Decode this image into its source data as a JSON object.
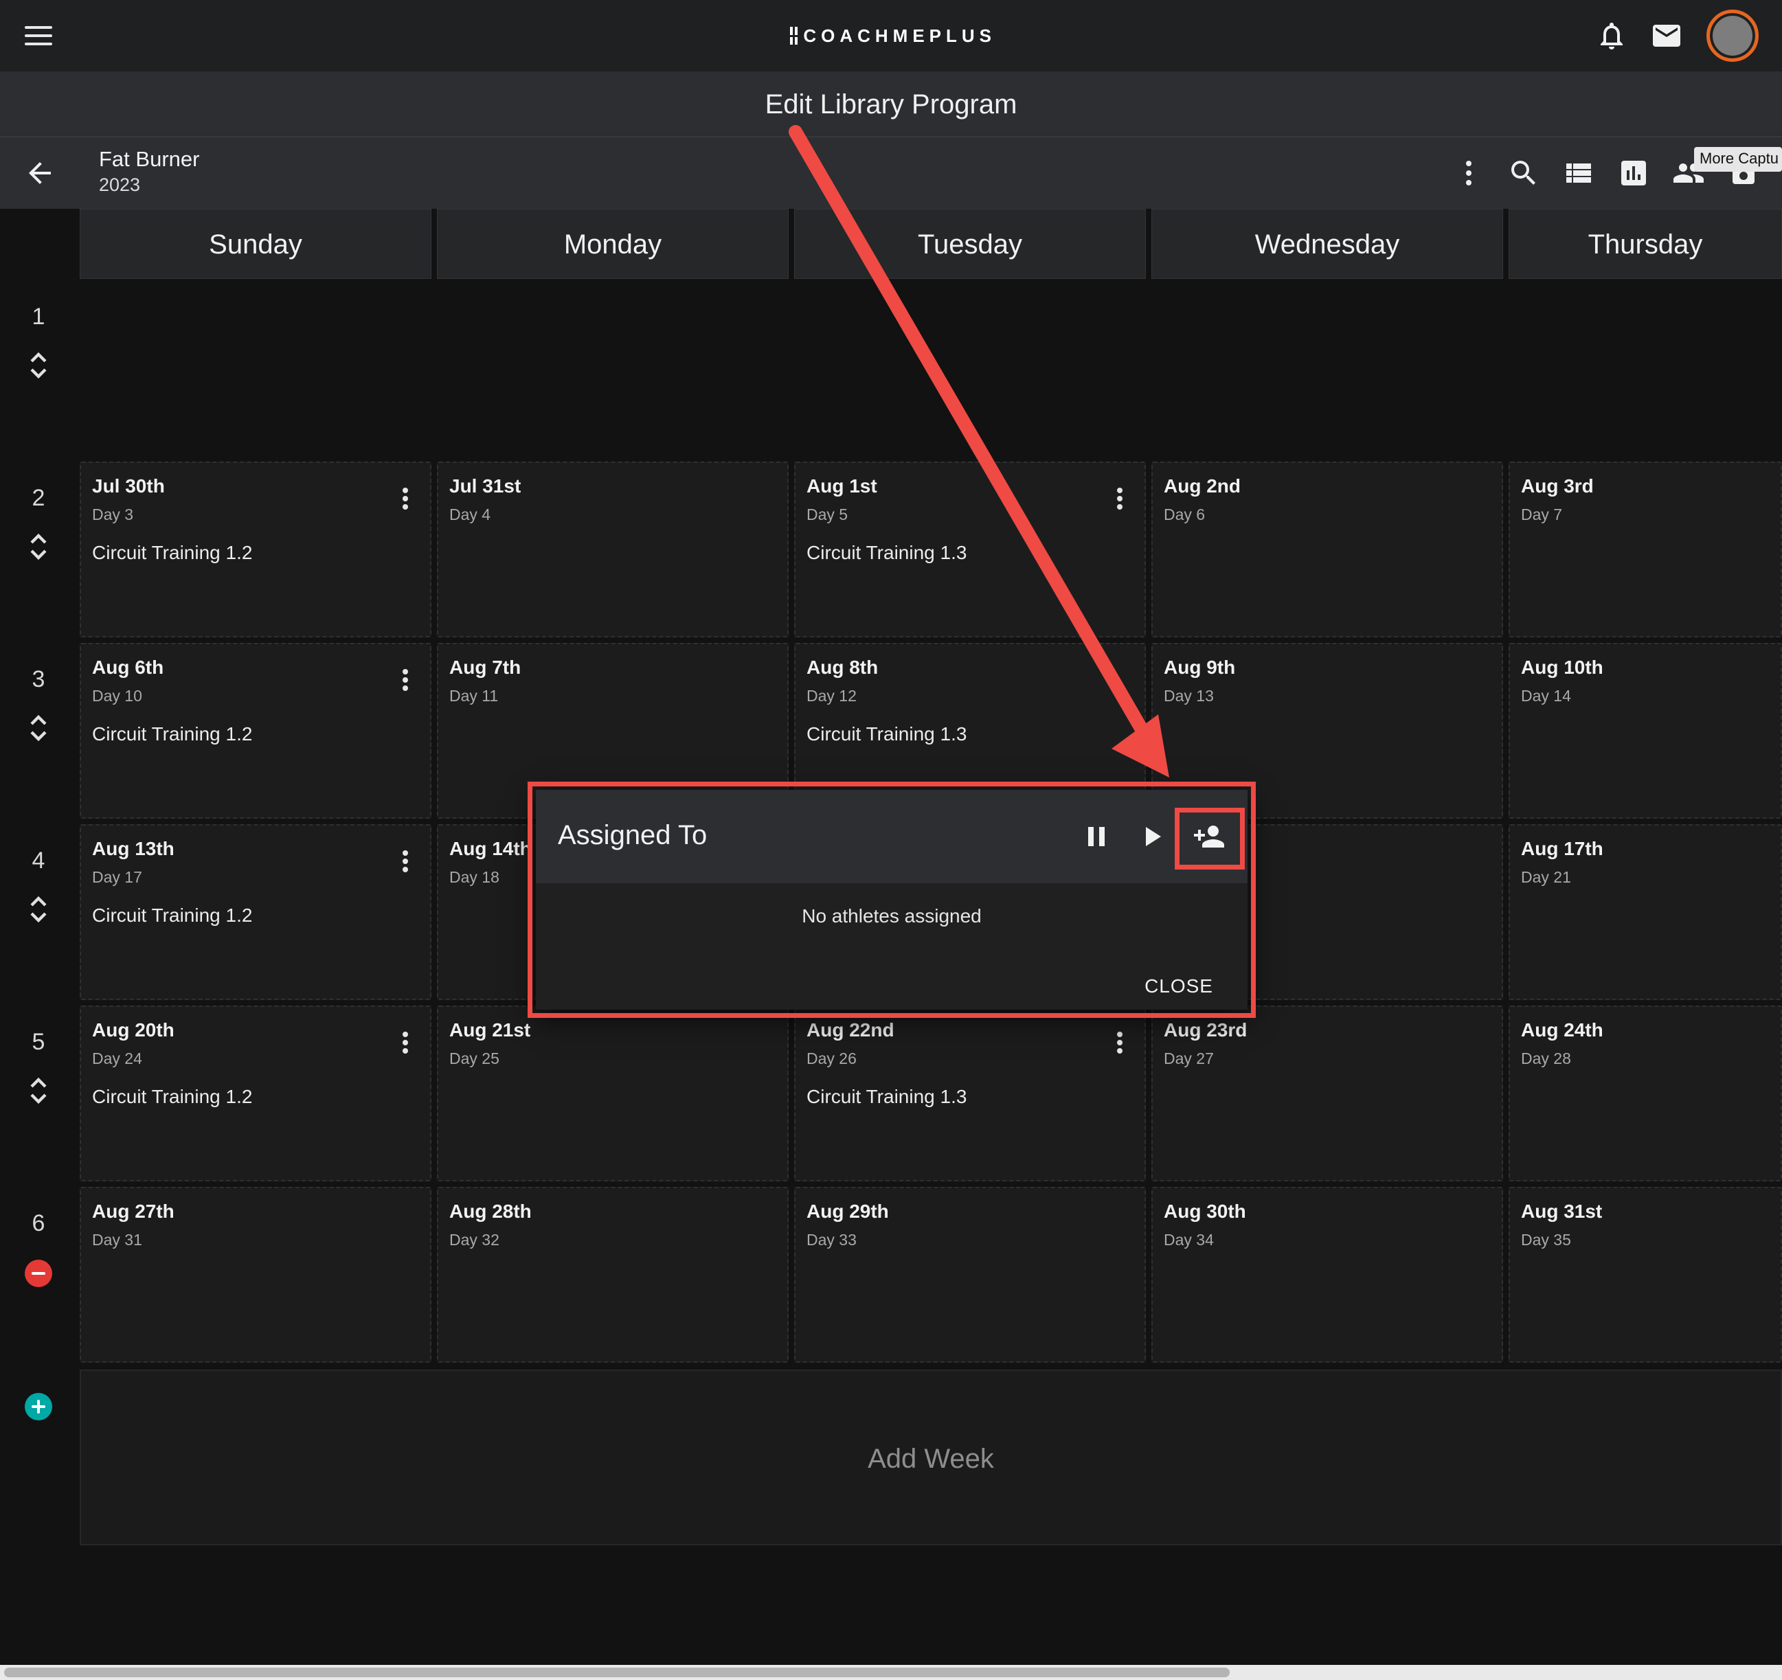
{
  "app": {
    "logo_text": "COACHMEPLUS",
    "page_title": "Edit Library Program"
  },
  "program": {
    "name": "Fat Burner",
    "year": "2023",
    "tooltip": "More Captu"
  },
  "calendar": {
    "days": [
      "Sunday",
      "Monday",
      "Tuesday",
      "Wednesday",
      "Thursday"
    ],
    "weeks": [
      {
        "number": "1",
        "cells": []
      },
      {
        "number": "2",
        "cells": [
          {
            "date": "Jul 30th",
            "day": "Day 3",
            "workout": "Circuit Training 1.2"
          },
          {
            "date": "Jul 31st",
            "day": "Day 4",
            "workout": ""
          },
          {
            "date": "Aug 1st",
            "day": "Day 5",
            "workout": "Circuit Training 1.3"
          },
          {
            "date": "Aug 2nd",
            "day": "Day 6",
            "workout": ""
          },
          {
            "date": "Aug 3rd",
            "day": "Day 7",
            "workout": ""
          }
        ]
      },
      {
        "number": "3",
        "cells": [
          {
            "date": "Aug 6th",
            "day": "Day 10",
            "workout": "Circuit Training 1.2"
          },
          {
            "date": "Aug 7th",
            "day": "Day 11",
            "workout": ""
          },
          {
            "date": "Aug 8th",
            "day": "Day 12",
            "workout": "Circuit Training 1.3"
          },
          {
            "date": "Aug 9th",
            "day": "Day 13",
            "workout": ""
          },
          {
            "date": "Aug 10th",
            "day": "Day 14",
            "workout": ""
          }
        ]
      },
      {
        "number": "4",
        "cells": [
          {
            "date": "Aug 13th",
            "day": "Day 17",
            "workout": "Circuit Training 1.2"
          },
          {
            "date": "Aug 14th",
            "day": "Day 18",
            "workout": ""
          },
          {
            "date": "",
            "day": "",
            "workout": ""
          },
          {
            "date": "",
            "day": "",
            "workout": ""
          },
          {
            "date": "Aug 17th",
            "day": "Day 21",
            "workout": ""
          }
        ]
      },
      {
        "number": "5",
        "cells": [
          {
            "date": "Aug 20th",
            "day": "Day 24",
            "workout": "Circuit Training 1.2"
          },
          {
            "date": "Aug 21st",
            "day": "Day 25",
            "workout": ""
          },
          {
            "date": "Aug 22nd",
            "day": "Day 26",
            "workout": "Circuit Training 1.3"
          },
          {
            "date": "Aug 23rd",
            "day": "Day 27",
            "workout": ""
          },
          {
            "date": "Aug 24th",
            "day": "Day 28",
            "workout": ""
          }
        ]
      },
      {
        "number": "6",
        "cells": [
          {
            "date": "Aug 27th",
            "day": "Day 31",
            "workout": ""
          },
          {
            "date": "Aug 28th",
            "day": "Day 32",
            "workout": ""
          },
          {
            "date": "Aug 29th",
            "day": "Day 33",
            "workout": ""
          },
          {
            "date": "Aug 30th",
            "day": "Day 34",
            "workout": ""
          },
          {
            "date": "Aug 31st",
            "day": "Day 35",
            "workout": ""
          }
        ]
      }
    ],
    "add_week_label": "Add Week"
  },
  "dialog": {
    "title": "Assigned To",
    "empty_text": "No athletes assigned",
    "close_label": "CLOSE"
  },
  "colors": {
    "annotation": "#ef4a44",
    "avatar_ring": "#e8661f",
    "remove_week": "#e53935",
    "add_week": "#00a9a5"
  }
}
